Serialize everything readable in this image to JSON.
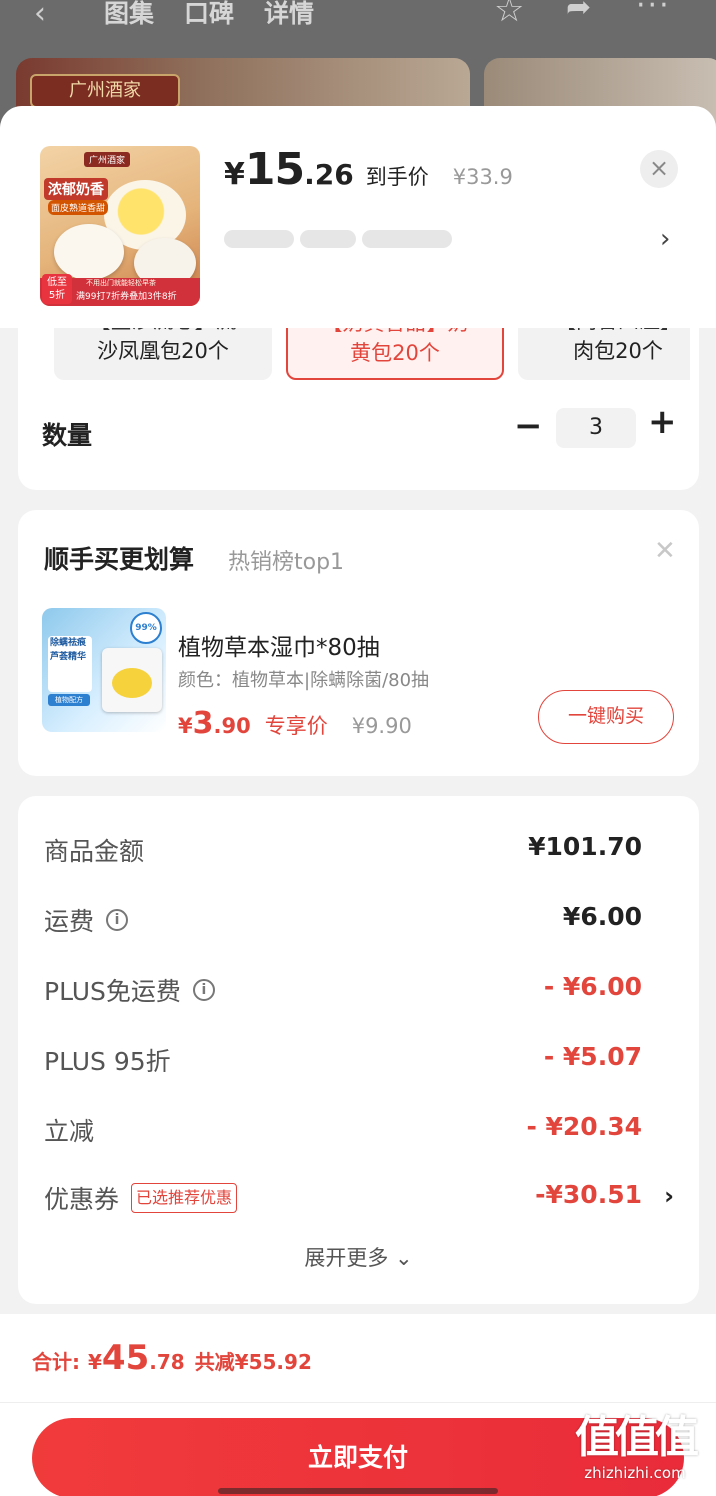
{
  "background_page": {
    "tabs": [
      "图集",
      "口碑",
      "详情"
    ],
    "shop_logo": "广州酒家"
  },
  "product": {
    "thumb_logo": "广州酒家",
    "thumb_tag": "浓郁奶香",
    "thumb_sub": "面皮熟道香甜",
    "thumb_low_line1": "低至",
    "thumb_low_line2": "5折",
    "thumb_promo": "满99打7折券叠加3件8折",
    "thumb_promo_small": "不用出门就能轻松早茶",
    "price_symbol": "¥",
    "price_int": "15",
    "price_dec": ".26",
    "price_label": "到手价",
    "original_price": "¥33.9"
  },
  "specs": {
    "options": [
      {
        "line1": "【金沙流心】流",
        "line2": "沙凤凰包20个",
        "selected": false
      },
      {
        "line1": "【奶黄香甜】奶",
        "line2": "黄包20个",
        "selected": true
      },
      {
        "line1": "【肉香四溢】",
        "line2": "肉包20个",
        "selected": false
      }
    ],
    "quantity_label": "数量",
    "quantity": "3"
  },
  "addon": {
    "title": "顺手买更划算",
    "subtitle": "热销榜top1",
    "product_name": "植物草本湿巾*80抽",
    "product_spec": "颜色：植物草本|除螨除菌/80抽",
    "price_symbol": "¥",
    "price_int": "3",
    "price_dec": ".90",
    "price_tag": "专享价",
    "original_price": "¥9.90",
    "buy_button": "一键购买",
    "image_text": [
      "除螨祛痕",
      "芦荟精华",
      "植物配方"
    ],
    "badge": "99%"
  },
  "summary": {
    "rows": [
      {
        "label": "商品金额",
        "value": "¥101.70"
      },
      {
        "label": "运费",
        "value": "¥6.00"
      },
      {
        "label": "PLUS免运费",
        "value": "- ¥6.00"
      },
      {
        "label": "PLUS 95折",
        "value": "- ¥5.07"
      },
      {
        "label": "立减",
        "value": "- ¥20.34"
      },
      {
        "label": "优惠券",
        "value": "-¥30.51",
        "tag": "已选推荐优惠"
      }
    ],
    "expand_label": "展开更多"
  },
  "footer": {
    "total_label": "合计:",
    "total_symbol": "¥",
    "total_int": "45",
    "total_dec": ".78",
    "saved": "共减¥55.92",
    "pay_button": "立即支付"
  },
  "watermark": {
    "logo": "值值值",
    "url": "zhizhizhi.com"
  },
  "colors": {
    "accent": "#e2453c",
    "pay_button": "#ee3439"
  }
}
